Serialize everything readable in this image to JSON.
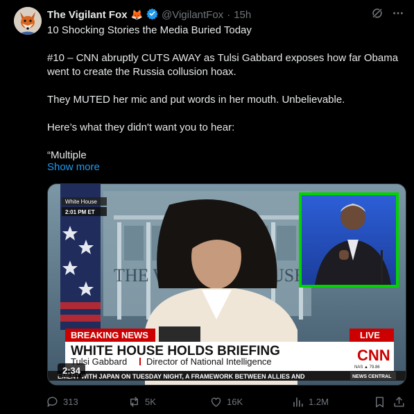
{
  "tweet": {
    "author_name": "The Vigilant Fox",
    "author_emoji": "🦊",
    "handle": "@VigilantFox",
    "separator": "·",
    "time": "15h",
    "lines": [
      "10 Shocking Stories the Media Buried Today",
      "#10 – CNN abruptly CUTS AWAY as Tulsi Gabbard exposes how far Obama went to create the Russia collusion hoax.",
      "They MUTED her mic and put words in her mouth. Unbelievable.",
      "Here’s what they didn't want you to hear:",
      "“Multiple"
    ],
    "show_more": "Show more"
  },
  "video": {
    "location_label": "White House",
    "time_label": "2:01 PM ET",
    "building_text": "THE W",
    "building_text2": "USE",
    "breaking": "BREAKING NEWS",
    "headline": "WHITE HOUSE HOLDS BRIEFING",
    "speaker": "Tulsi Gabbard",
    "speaker_title": "Director of National Intelligence",
    "live": "LIVE",
    "network": "CNN",
    "ticker_index": "NAS ▲ 79.86",
    "ticker": "EMENT WITH JAPAN ON TUESDAY NIGHT, A FRAMEWORK BETWEEN ALLIES AND",
    "news_central": "NEWS CENTRAL",
    "duration": "2:34"
  },
  "actions": {
    "replies": "313",
    "reposts": "5K",
    "likes": "16K",
    "views": "1.2M"
  },
  "colors": {
    "accent": "#1d9bf0",
    "breaking_red": "#cc0000",
    "highlight_green": "#00d400",
    "verified": "#1d9bf0"
  }
}
